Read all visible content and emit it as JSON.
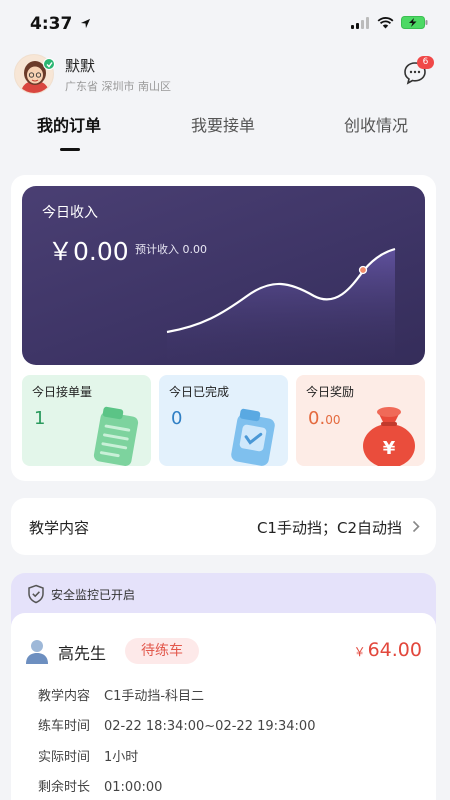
{
  "status_bar": {
    "time": "4:37"
  },
  "profile": {
    "name": "默默",
    "location": "广东省 深圳市 南山区",
    "message_count": "6"
  },
  "tabs": [
    {
      "label": "我的订单",
      "active": true
    },
    {
      "label": "我要接单",
      "active": false
    },
    {
      "label": "创收情况",
      "active": false
    }
  ],
  "income": {
    "title": "今日收入",
    "amount": "￥0.00",
    "estimate_label": "预计收入 0.00"
  },
  "stats": [
    {
      "label": "今日接单量",
      "value": "1",
      "color": "#2a9a5d",
      "bg": "#e3f6ea"
    },
    {
      "label": "今日已完成",
      "value": "0",
      "color": "#2f7fc4",
      "bg": "#e3f1fc"
    },
    {
      "label": "今日奖励",
      "value": "0.",
      "value_small": "00",
      "color": "#e46a3e",
      "bg": "#fdece6"
    }
  ],
  "teaching": {
    "label": "教学内容",
    "value": "C1手动挡；C2自动挡"
  },
  "safety": {
    "text": "安全监控已开启"
  },
  "order": {
    "customer": "高先生",
    "status": "待练车",
    "price_symbol": "￥",
    "price": "64.00",
    "rows": [
      {
        "key": "教学内容",
        "value": "C1手动挡-科目二"
      },
      {
        "key": "练车时间",
        "value": "02-22 18:34:00~02-22 19:34:00"
      },
      {
        "key": "实际时间",
        "value": "1小时"
      },
      {
        "key": "剩余时长",
        "value": "01:00:00"
      }
    ]
  },
  "colors": {
    "accent_purple": "#3d3465",
    "danger": "#e2473c",
    "safety_bg": "#e5e2fa"
  }
}
